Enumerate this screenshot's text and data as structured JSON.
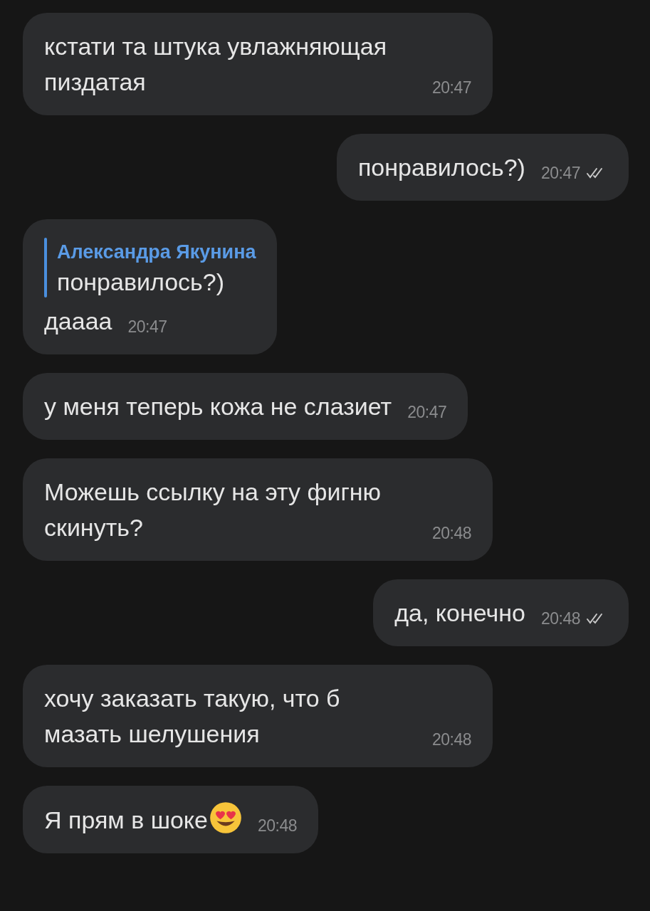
{
  "messages": [
    {
      "kind": "in",
      "text": "кстати та штука увлажняющая пиздатая",
      "time": "20:47"
    },
    {
      "kind": "out",
      "text": "понравилось?)",
      "time": "20:47",
      "read": true
    },
    {
      "kind": "in",
      "reply": {
        "author": "Александра Якунина",
        "text": "понравилось?)"
      },
      "text": "даааа",
      "time": "20:47"
    },
    {
      "kind": "in",
      "text": "у меня теперь кожа не слазиет",
      "time": "20:47"
    },
    {
      "kind": "in",
      "text": "Можешь ссылку на эту фигню скинуть?",
      "time": "20:48"
    },
    {
      "kind": "out",
      "text": "да, конечно",
      "time": "20:48",
      "read": true
    },
    {
      "kind": "in",
      "text": "хочу заказать такую, что б мазать шелушения",
      "time": "20:48"
    },
    {
      "kind": "in",
      "text": "Я прям в шоке",
      "emoji": {
        "kind": "heart_eyes"
      },
      "time": "20:48"
    }
  ]
}
